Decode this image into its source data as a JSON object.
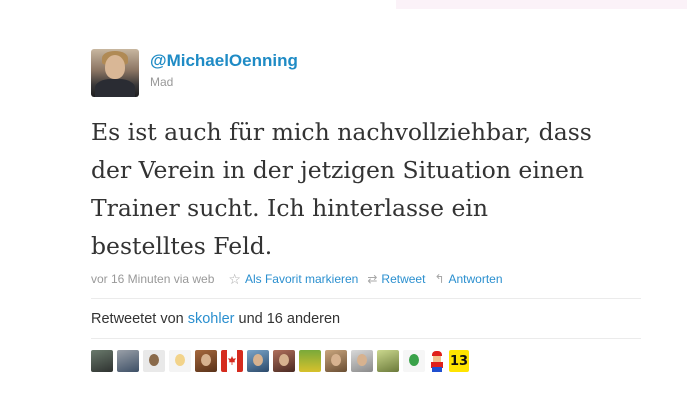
{
  "profile": {
    "screen_name": "@MichaelOenning",
    "full_name": "Mad"
  },
  "tweet": {
    "lines": [
      "Es ist auch für mich nachvollziehbar, dass",
      "der Verein in der jetzigen Situation einen",
      "Trainer sucht. Ich hinterlasse ein",
      "bestelltes Feld."
    ]
  },
  "meta": {
    "timestamp": "vor 16 Minuten via web",
    "favorite_label": "Als Favorit markieren",
    "retweet_label": "Retweet",
    "reply_label": "Antworten"
  },
  "retweets": {
    "prefix": "Retweetet von",
    "user": "skohler",
    "suffix": "und 16 anderen",
    "badge_text": "13"
  },
  "icons": {
    "favorite": "star-icon",
    "retweet": "retweet-icon",
    "reply": "reply-icon"
  },
  "colors": {
    "link": "#2a8fcf",
    "screen_name": "#1f8bc5",
    "muted": "#999999",
    "text": "#333333"
  }
}
